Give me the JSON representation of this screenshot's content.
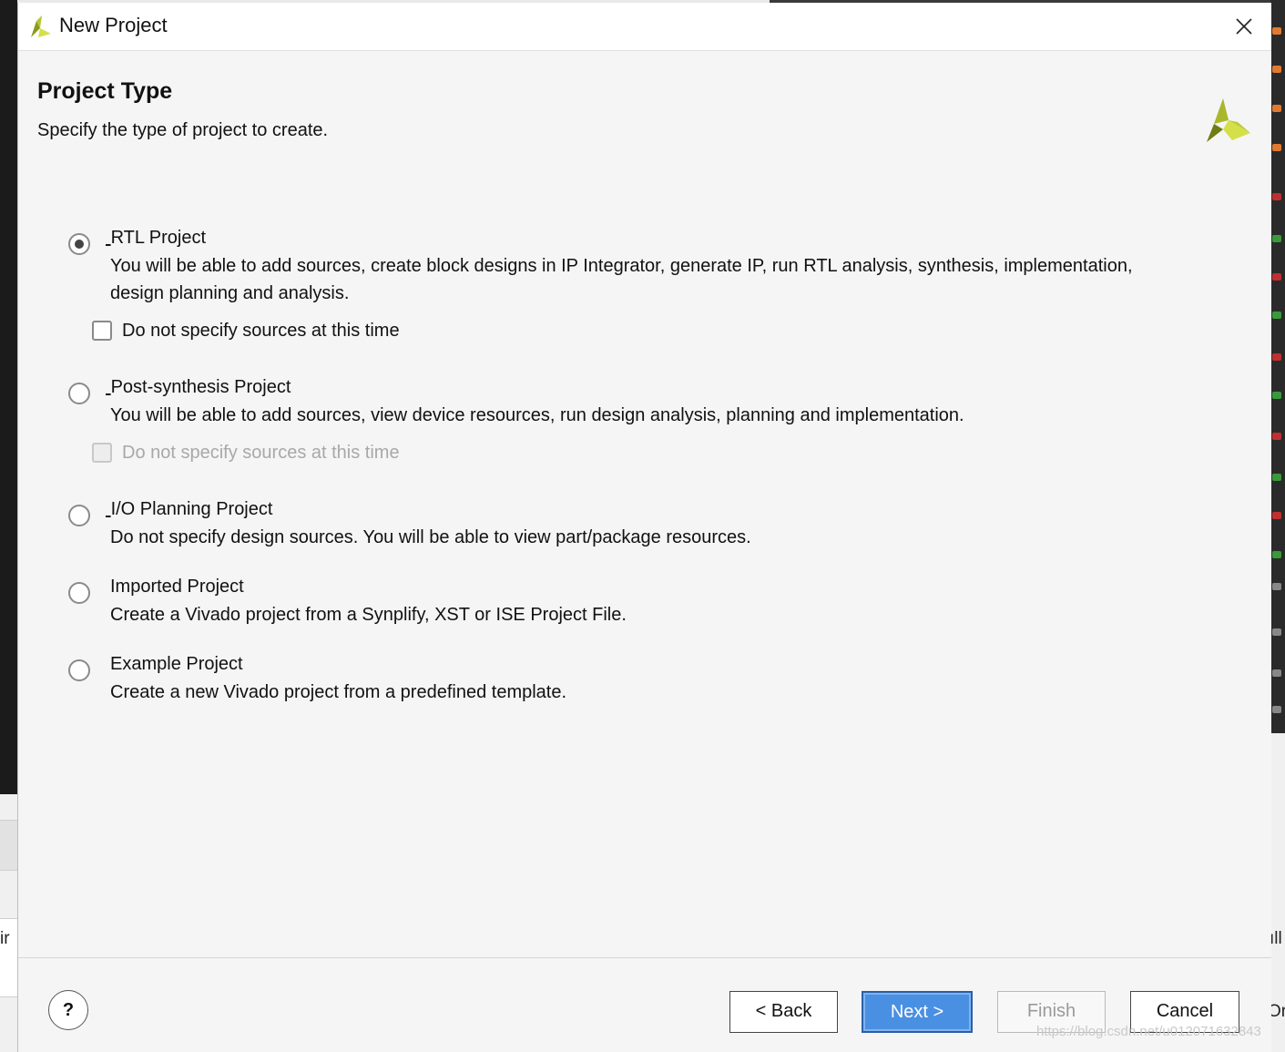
{
  "window": {
    "title": "New Project",
    "close_icon": "close-icon",
    "app_icon": "vivado-logo-icon"
  },
  "page": {
    "title": "Project Type",
    "subtitle": "Specify the type of project to create."
  },
  "options": [
    {
      "label": "RTL Project",
      "underlined_mnemonic": "R",
      "description": [
        "You will be able to add sources, create block designs in IP Integrator, generate IP, run RTL analysis, synthesis, implementation,",
        "design planning and analysis."
      ],
      "selected": true,
      "checkbox": {
        "label": "Do not specify sources at this time",
        "checked": false,
        "enabled": true
      }
    },
    {
      "label": "Post-synthesis Project",
      "underlined_mnemonic": "P",
      "description": [
        "You will be able to add sources, view device resources, run design analysis, planning and implementation."
      ],
      "selected": false,
      "checkbox": {
        "label": "Do not specify sources at this time",
        "checked": false,
        "enabled": false
      }
    },
    {
      "label": "I/O Planning Project",
      "underlined_mnemonic": "I",
      "description": [
        "Do not specify design sources. You will be able to view part/package resources."
      ],
      "selected": false
    },
    {
      "label": "Imported Project",
      "underlined_mnemonic": "m",
      "description": [
        "Create a Vivado project from a Synplify, XST or ISE Project File."
      ],
      "selected": false
    },
    {
      "label": "Example Project",
      "underlined_mnemonic": "x",
      "description": [
        "Create a new Vivado project from a predefined template."
      ],
      "selected": false
    }
  ],
  "footer": {
    "help_label": "?",
    "back_label": "< Back",
    "next_label": "Next >",
    "finish_label": "Finish",
    "cancel_label": "Cancel",
    "next_is_default": true,
    "finish_enabled": false
  },
  "background": {
    "left_text": "ir",
    "right_text_1": "ıll",
    "right_text_2": "Or"
  },
  "watermark": "https://blog.csdn.net/u012071632843",
  "colors": {
    "primary_button": "#4a90e2",
    "logo_green": "#8a9a1a",
    "logo_yellow": "#d4e04a"
  }
}
